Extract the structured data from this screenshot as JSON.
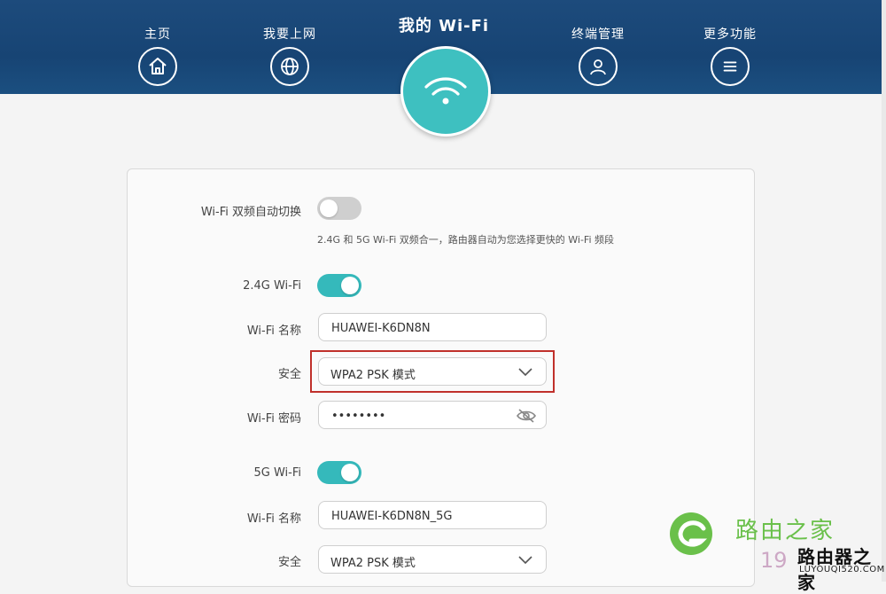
{
  "nav": {
    "items": [
      {
        "label": "主页",
        "icon": "home-icon"
      },
      {
        "label": "我要上网",
        "icon": "globe-icon"
      },
      {
        "label": "我的 Wi-Fi",
        "icon": "wifi-icon",
        "active": true
      },
      {
        "label": "终端管理",
        "icon": "user-icon"
      },
      {
        "label": "更多功能",
        "icon": "menu-icon"
      }
    ]
  },
  "settings": {
    "dual_band": {
      "label": "Wi-Fi 双频自动切换",
      "enabled": false,
      "hint": "2.4G 和 5G Wi-Fi 双频合一，路由器自动为您选择更快的 Wi-Fi 频段"
    },
    "band_24": {
      "label": "2.4G Wi-Fi",
      "enabled": true,
      "name_label": "Wi-Fi 名称",
      "name_value": "HUAWEI-K6DN8N",
      "security_label": "安全",
      "security_value": "WPA2 PSK 模式",
      "password_label": "Wi-Fi 密码",
      "password_value": "••••••••"
    },
    "band_5": {
      "label": "5G Wi-Fi",
      "enabled": true,
      "name_label": "Wi-Fi 名称",
      "name_value": "HUAWEI-K6DN8N_5G",
      "security_label": "安全",
      "security_value": "WPA2 PSK 模式"
    }
  },
  "watermark": {
    "brand_cn": "路由之家",
    "number": "19",
    "brand_cn2": "路由器之家",
    "url": "LUYOUQI520.COM"
  },
  "colors": {
    "header": "#1d4b7c",
    "accent": "#35b9bb",
    "highlight": "#c0302b"
  }
}
